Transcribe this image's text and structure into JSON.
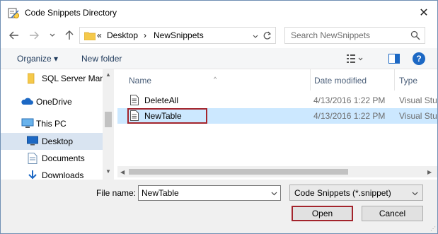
{
  "window": {
    "title": "Code Snippets Directory",
    "close_glyph": "✕"
  },
  "address_bar": {
    "overflow": "«",
    "crumbs": [
      "Desktop",
      "NewSnippets"
    ],
    "separator": "›"
  },
  "search": {
    "placeholder": "Search NewSnippets"
  },
  "toolbar": {
    "organize_label": "Organize ▾",
    "new_folder_label": "New folder",
    "help_glyph": "?"
  },
  "nav_pane": {
    "items": [
      {
        "label": "SQL Server Mana",
        "icon": "folder-icon"
      },
      {
        "label": "OneDrive",
        "icon": "cloud-icon"
      },
      {
        "label": "This PC",
        "icon": "computer-icon"
      },
      {
        "label": "Desktop",
        "icon": "desktop-icon",
        "selected": true
      },
      {
        "label": "Documents",
        "icon": "documents-icon"
      },
      {
        "label": "Downloads",
        "icon": "download-icon"
      }
    ]
  },
  "file_list": {
    "columns": [
      "Name",
      "Date modified",
      "Type"
    ],
    "rows": [
      {
        "name": "DeleteAll",
        "date": "4/13/2016 1:22 PM",
        "type": "Visual Stu"
      },
      {
        "name": "NewTable",
        "date": "4/13/2016 1:22 PM",
        "type": "Visual Stu",
        "selected": true
      }
    ]
  },
  "bottom": {
    "file_name_label": "File name:",
    "file_name_value": "NewTable",
    "filter_value": "Code Snippets (*.snippet)",
    "open_label": "Open",
    "cancel_label": "Cancel"
  },
  "colors": {
    "accent": "#1c68c4",
    "selection": "#cce8ff",
    "highlight_border": "#a3242c"
  }
}
